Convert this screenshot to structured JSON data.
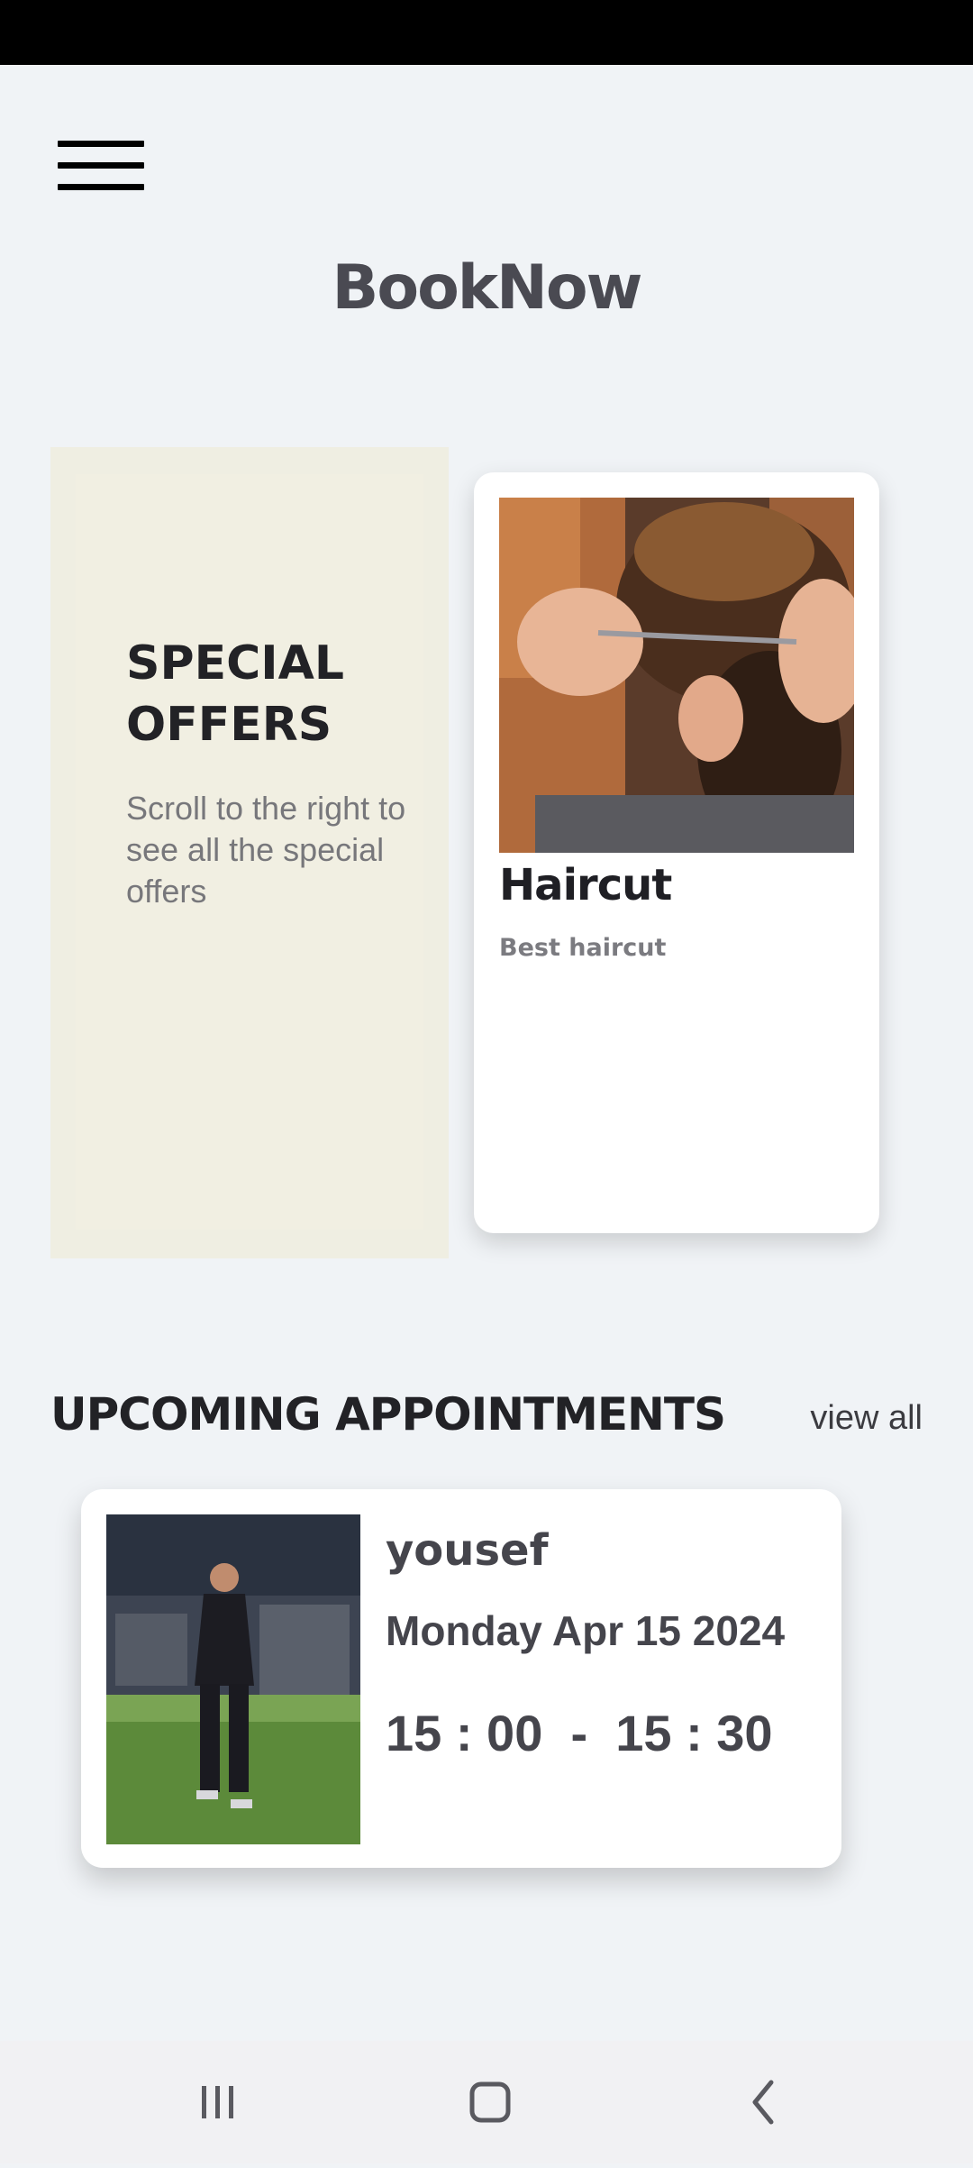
{
  "app": {
    "title": "BookNow",
    "menu_icon": "hamburger-menu-icon"
  },
  "special_offers": {
    "heading": "SPECIAL OFFERS",
    "description": "Scroll to the right to see all the special offers",
    "items": [
      {
        "title": "Haircut",
        "subtitle": "Best haircut"
      }
    ]
  },
  "appointments": {
    "section_title": "UPCOMING APPOINTMENTS",
    "view_all_label": "view all",
    "items": [
      {
        "name": "yousef",
        "date": "Monday Apr 15 2024",
        "time": "15 : 00  -  15 : 30"
      }
    ]
  },
  "nav_bar": {
    "icons": [
      "recent-apps-icon",
      "home-icon",
      "back-icon"
    ]
  }
}
